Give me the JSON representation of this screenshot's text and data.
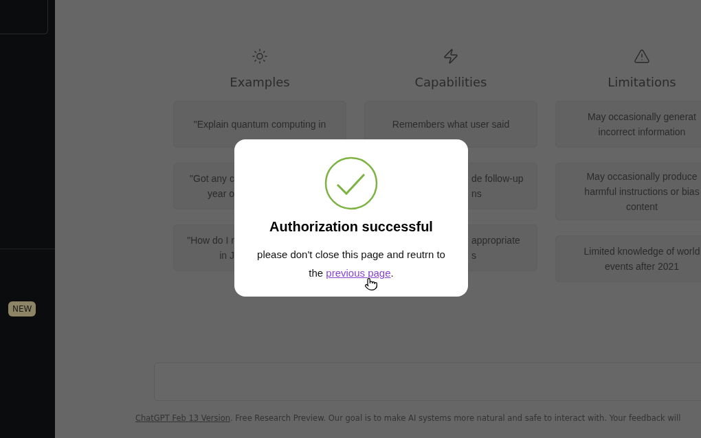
{
  "sidebar": {
    "badge": "NEW"
  },
  "columns": [
    {
      "title": "Examples",
      "cards": [
        {
          "lines": [
            "\"Explain quantum computing in"
          ]
        },
        {
          "lines": [
            "\"Got any c",
            "year o"
          ]
        },
        {
          "lines": [
            "\"How do I r",
            "in J"
          ]
        }
      ]
    },
    {
      "title": "Capabilities",
      "cards": [
        {
          "lines": [
            "Remembers what user said"
          ]
        },
        {
          "lines": [
            "de follow-up",
            "ns"
          ]
        },
        {
          "lines": [
            "appropriate",
            "s"
          ]
        }
      ]
    },
    {
      "title": "Limitations",
      "cards": [
        {
          "lines": [
            "May occasionally generat",
            "incorrect information"
          ]
        },
        {
          "lines": [
            "May occasionally produce",
            "harmful instructions or bias",
            "content"
          ]
        },
        {
          "lines": [
            "Limited knowledge of world",
            "events after 2021"
          ]
        }
      ]
    }
  ],
  "footer": {
    "link": "ChatGPT Feb 13 Version",
    "text": ". Free Research Preview. Our goal is to make AI systems more natural and safe to interact with. Your feedback will"
  },
  "modal": {
    "title": "Authorization successful",
    "message": "please don't close this page and reutrn to the",
    "link": "previous page",
    "end": "."
  }
}
